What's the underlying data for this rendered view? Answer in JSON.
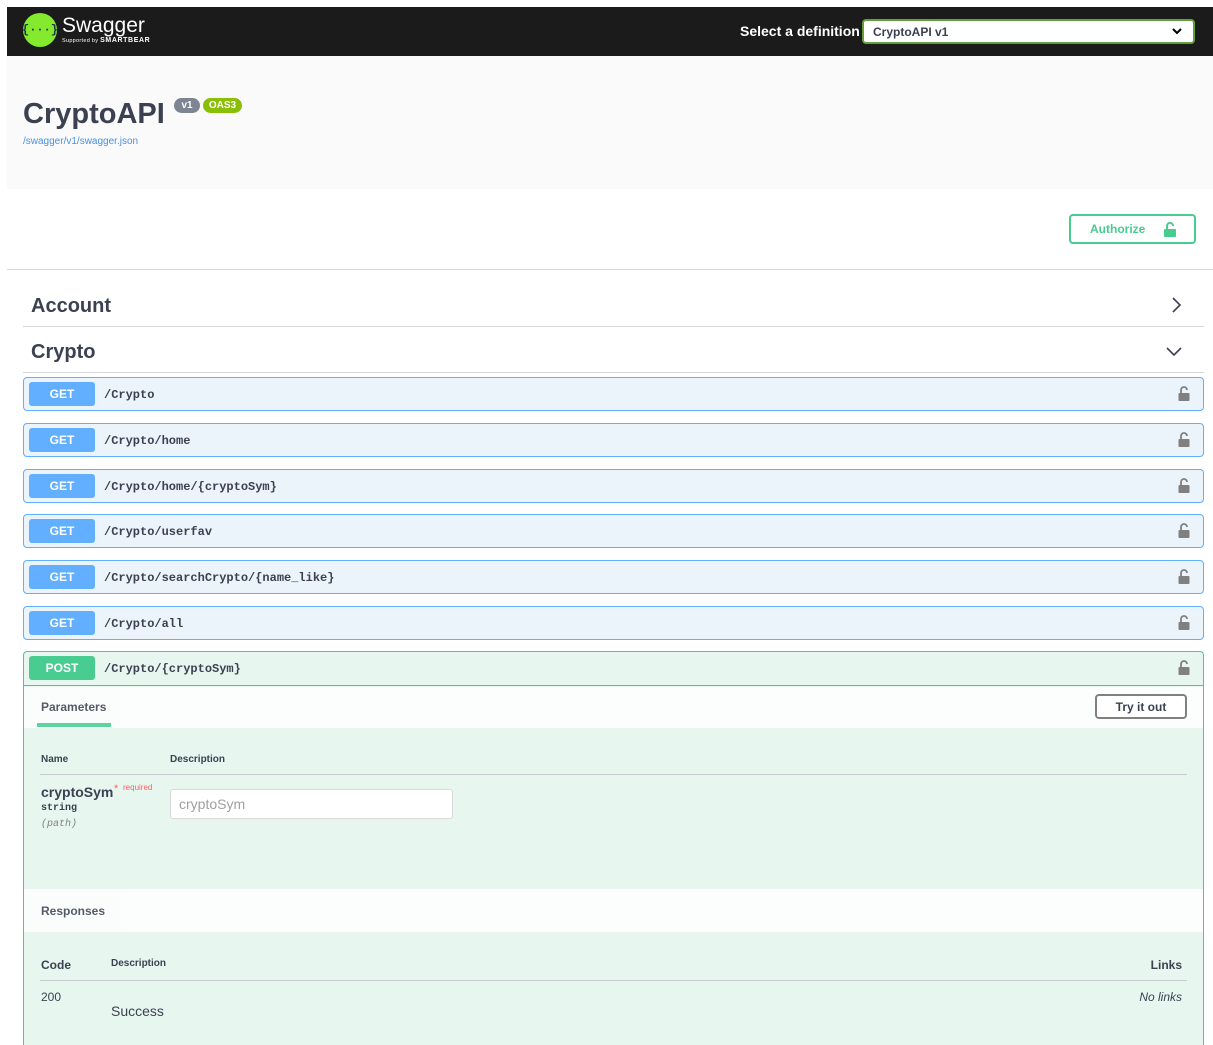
{
  "topbar": {
    "logo_glyph": "{···}",
    "logo_name": "Swagger",
    "logo_sub_prefix": "Supported by",
    "logo_sub_brand": "SMARTBEAR",
    "definition_label": "Select a definition",
    "definition_value": "CryptoAPI v1"
  },
  "info": {
    "title": "CryptoAPI",
    "version": "v1",
    "oas": "OAS3",
    "url": "/swagger/v1/swagger.json"
  },
  "authorize": {
    "label": "Authorize"
  },
  "tags": [
    {
      "name": "Account",
      "expanded": false
    },
    {
      "name": "Crypto",
      "expanded": true
    }
  ],
  "operations": [
    {
      "method": "GET",
      "path": "/Crypto"
    },
    {
      "method": "GET",
      "path": "/Crypto/home"
    },
    {
      "method": "GET",
      "path": "/Crypto/home/{cryptoSym}"
    },
    {
      "method": "GET",
      "path": "/Crypto/userfav"
    },
    {
      "method": "GET",
      "path": "/Crypto/searchCrypto/{name_like}"
    },
    {
      "method": "GET",
      "path": "/Crypto/all"
    }
  ],
  "post_op": {
    "method": "POST",
    "path": "/Crypto/{cryptoSym}",
    "parameters_tab": "Parameters",
    "try_label": "Try it out",
    "col_name": "Name",
    "col_description": "Description",
    "param": {
      "name": "cryptoSym",
      "required_star": "*",
      "required_label": "required",
      "type": "string",
      "in": "(path)",
      "placeholder": "cryptoSym"
    },
    "responses_title": "Responses",
    "col_code": "Code",
    "col_resp_description": "Description",
    "col_links": "Links",
    "response": {
      "code": "200",
      "description": "Success",
      "links": "No links"
    }
  },
  "colors": {
    "get": "#61affe",
    "post": "#49cc90",
    "topbar": "#1b1b1b",
    "logo": "#85ea2d"
  }
}
